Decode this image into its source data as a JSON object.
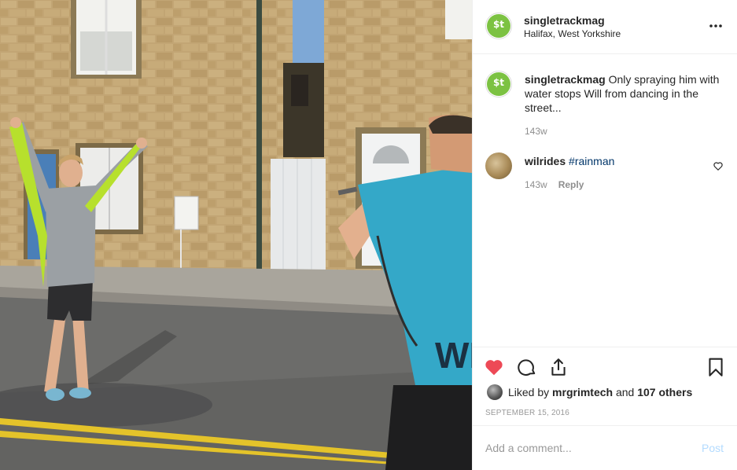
{
  "post": {
    "username": "singletrackmag",
    "location": "Halifax, West Yorkshire",
    "more_icon": "more-horizontal-icon"
  },
  "caption": {
    "username": "singletrackmag",
    "text": "Only spraying him with water stops Will from dancing in the street...",
    "time": "143w"
  },
  "comments": [
    {
      "username": "wilrides",
      "text": "#rainman",
      "time": "143w",
      "reply_label": "Reply"
    }
  ],
  "actions": {
    "like_icon": "heart-filled-icon",
    "comment_icon": "comment-icon",
    "share_icon": "share-icon",
    "save_icon": "bookmark-icon"
  },
  "likes": {
    "prefix": "Liked by",
    "user": "mrgrimtech",
    "joiner": "and",
    "others": "107 others"
  },
  "date": "September 15, 2016",
  "add_comment": {
    "placeholder": "Add a comment...",
    "post_label": "Post"
  },
  "colors": {
    "brand_green": "#7cc242",
    "like_red": "#ed4956",
    "post_disabled": "#b3dbff",
    "hashtag": "#003569"
  }
}
